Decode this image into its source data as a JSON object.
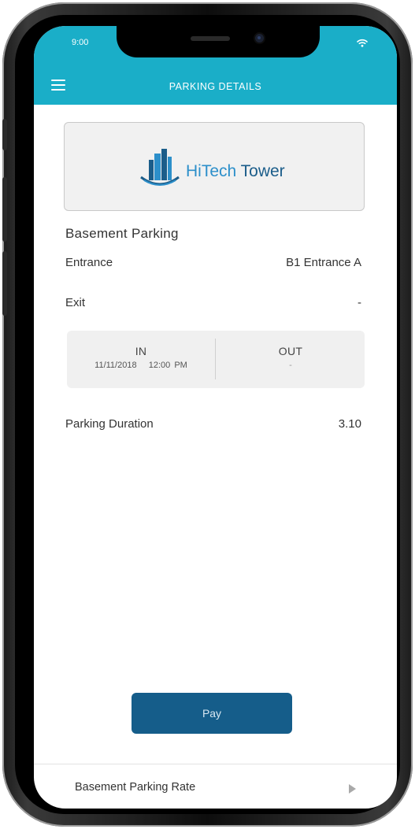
{
  "status_bar": {
    "time": "9:00"
  },
  "header": {
    "title": "PARKING DETAILS"
  },
  "logo": {
    "brand_hi": "HiTech",
    "brand_rest": " Tower"
  },
  "parking": {
    "area": "Basement Parking",
    "entrance_label": "Entrance",
    "entrance_value": "B1 Entrance A",
    "exit_label": "Exit",
    "exit_value": "-"
  },
  "in_out": {
    "in_label": "IN",
    "in_value": "11/11/2018   12:00 PM",
    "out_label": "OUT",
    "out_value": "-"
  },
  "duration": {
    "label": "Parking Duration",
    "value": "3.10"
  },
  "actions": {
    "pay_label": "Pay"
  },
  "footer": {
    "rate_label": "Basement Parking Rate"
  },
  "colors": {
    "header": "#1aaec8",
    "pay_button": "#155d8a",
    "brand": "#1b5d8a"
  }
}
